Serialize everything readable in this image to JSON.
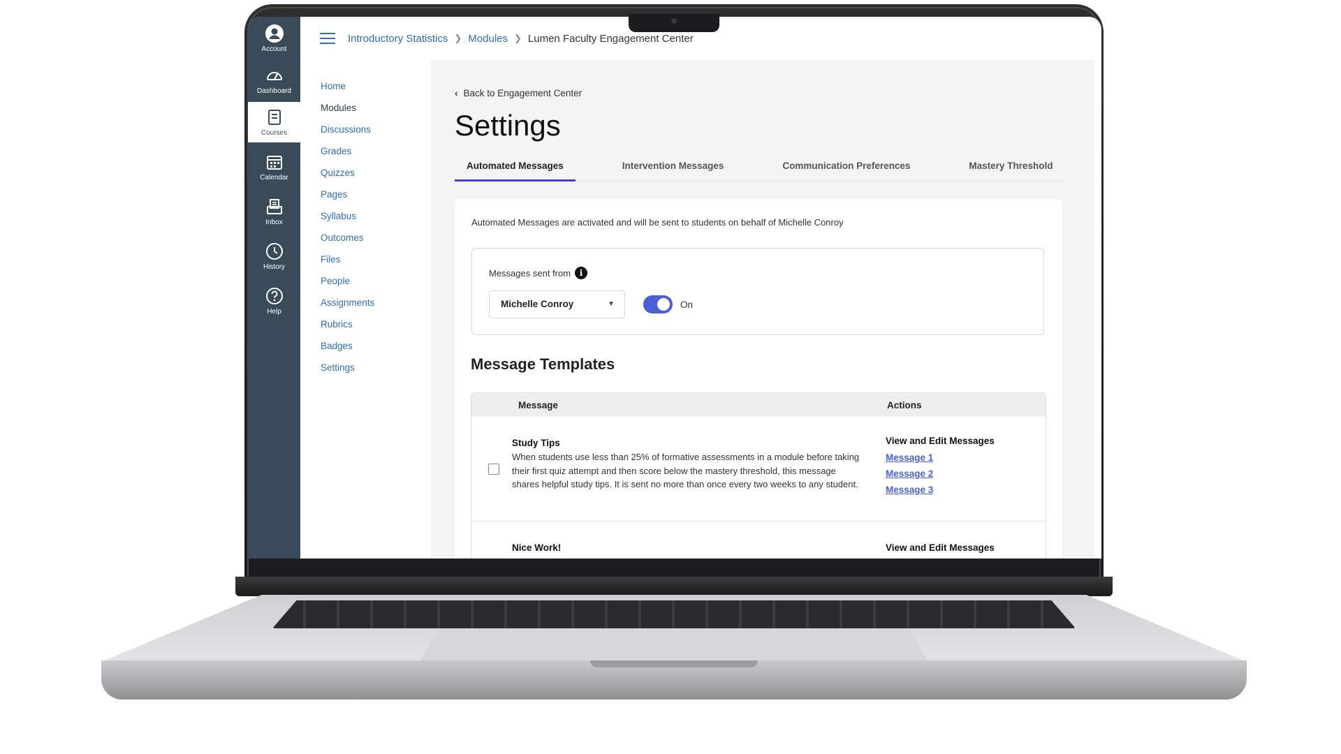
{
  "global_nav": [
    {
      "label": "Account",
      "icon": "account-icon"
    },
    {
      "label": "Dashboard",
      "icon": "dashboard-icon"
    },
    {
      "label": "Courses",
      "icon": "courses-icon",
      "active": true
    },
    {
      "label": "Calendar",
      "icon": "calendar-icon"
    },
    {
      "label": "Inbox",
      "icon": "inbox-icon"
    },
    {
      "label": "History",
      "icon": "history-icon"
    },
    {
      "label": "Help",
      "icon": "help-icon"
    }
  ],
  "breadcrumb": {
    "course": "Introductory Statistics",
    "section": "Modules",
    "current": "Lumen Faculty Engagement Center"
  },
  "course_nav": [
    "Home",
    "Modules",
    "Discussions",
    "Grades",
    "Quizzes",
    "Pages",
    "Syllabus",
    "Outcomes",
    "Files",
    "People",
    "Assignments",
    "Rubrics",
    "Badges",
    "Settings"
  ],
  "course_nav_active": "Modules",
  "page": {
    "back_link": "Back to Engagement Center",
    "title": "Settings",
    "tabs": [
      "Automated Messages",
      "Intervention Messages",
      "Communication Preferences",
      "Mastery Threshold"
    ],
    "active_tab": "Automated Messages"
  },
  "automated": {
    "notice": "Automated Messages are activated and will be sent to students on behalf of Michelle Conroy",
    "sent_from_label": "Messages sent from",
    "sender": "Michelle Conroy",
    "toggle_on": true,
    "toggle_label": "On"
  },
  "templates": {
    "title": "Message Templates",
    "col_message": "Message",
    "col_actions": "Actions",
    "rows": [
      {
        "title": "Study Tips",
        "description": "When students use less than 25% of formative assessments in a module before taking their first quiz attempt and then score below the mastery threshold, this message shares helpful study tips. It is sent no more than once every two weeks to any student.",
        "actions_title": "View and Edit Messages",
        "links": [
          "Message 1",
          "Message 2",
          "Message 3"
        ]
      },
      {
        "title": "Nice Work!",
        "actions_title": "View and Edit Messages"
      }
    ]
  },
  "colors": {
    "nav_bg": "#394b58",
    "link": "#2d6db5",
    "accent": "#4a5fd6"
  }
}
